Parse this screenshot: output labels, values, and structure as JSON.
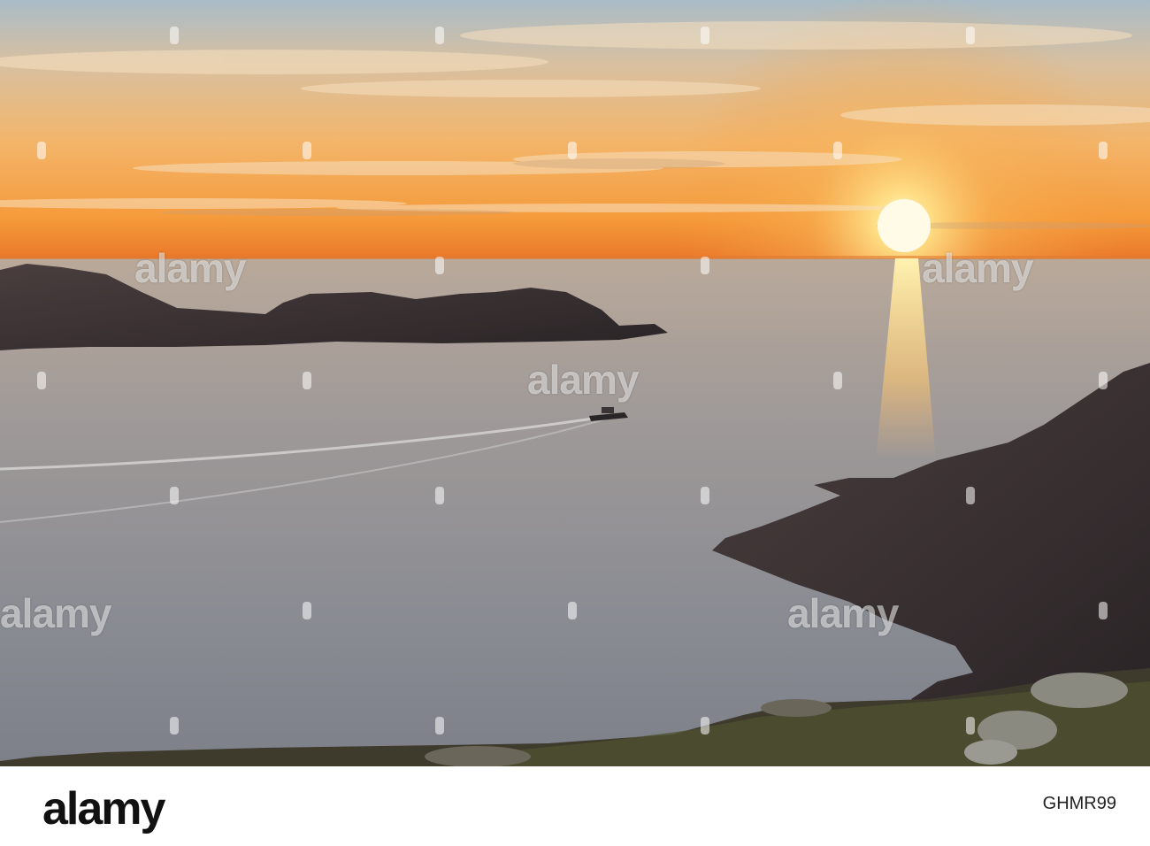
{
  "watermark": {
    "text": "alamy"
  },
  "footer": {
    "logo": "alamy",
    "image_id": "GHMR99"
  },
  "colors": {
    "sky_top": "#b9c7cf",
    "sky_mid": "#f2b46a",
    "horizon": "#f28c2a",
    "sun": "#fff6c8",
    "sea": "#8f8f91",
    "rock": "#3a3234"
  }
}
